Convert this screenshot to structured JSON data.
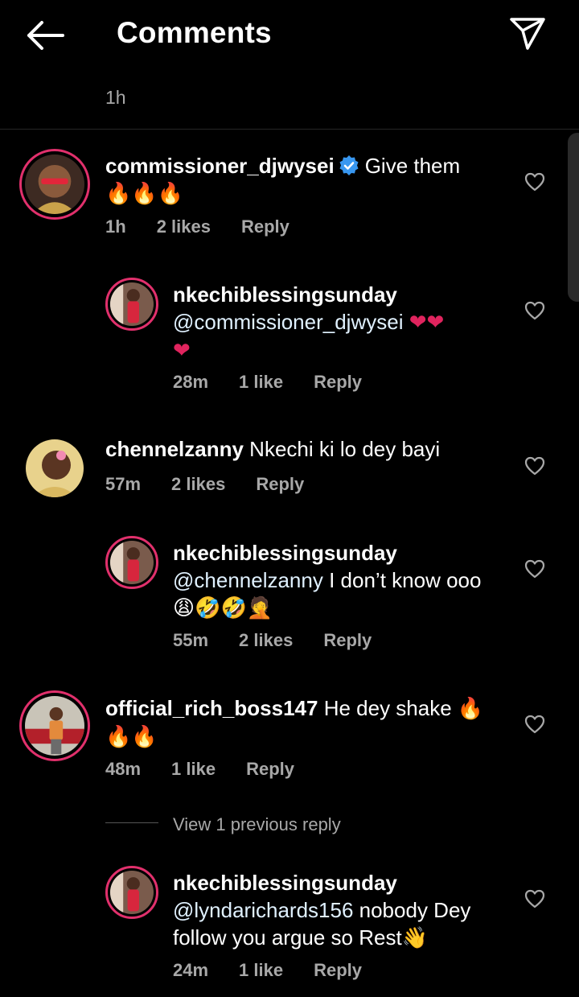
{
  "header": {
    "title": "Comments"
  },
  "top_time": "1h",
  "comments": [
    {
      "username": "commissioner_djwysei",
      "verified": true,
      "text": "Give them",
      "emojis": "🔥🔥🔥",
      "time": "1h",
      "likes": "2 likes",
      "reply": "Reply"
    },
    {
      "username": "nkechiblessingsunday",
      "mention": "@commissioner_djwysei",
      "text": "",
      "emojis": "❤❤",
      "emojis2": "❤",
      "time": "28m",
      "likes": "1 like",
      "reply": "Reply"
    },
    {
      "username": "chennelzanny",
      "text": "Nkechi ki lo dey bayi",
      "time": "57m",
      "likes": "2 likes",
      "reply": "Reply"
    },
    {
      "username": "nkechiblessingsunday",
      "mention": "@chennelzanny",
      "text": "I don’t know ooo",
      "emojis": "😩🤣🤣🤦",
      "time": "55m",
      "likes": "2 likes",
      "reply": "Reply"
    },
    {
      "username": "official_rich_boss147",
      "text": "He dey shake",
      "emojis": "🔥",
      "emojis2": "🔥🔥",
      "time": "48m",
      "likes": "1 like",
      "reply": "Reply"
    },
    {
      "username": "nkechiblessingsunday",
      "mention": "@lyndarichards156",
      "text": "nobody Dey",
      "text2": "follow you argue so Rest",
      "emojis": "👋",
      "time": "24m",
      "likes": "1 like",
      "reply": "Reply"
    }
  ],
  "view_previous": "View 1 previous reply",
  "colors": {
    "background": "#000000",
    "muted": "#a8a8a8",
    "verified": "#3897f0",
    "heart_red": "#e0245e",
    "ring": "#e1306c"
  }
}
